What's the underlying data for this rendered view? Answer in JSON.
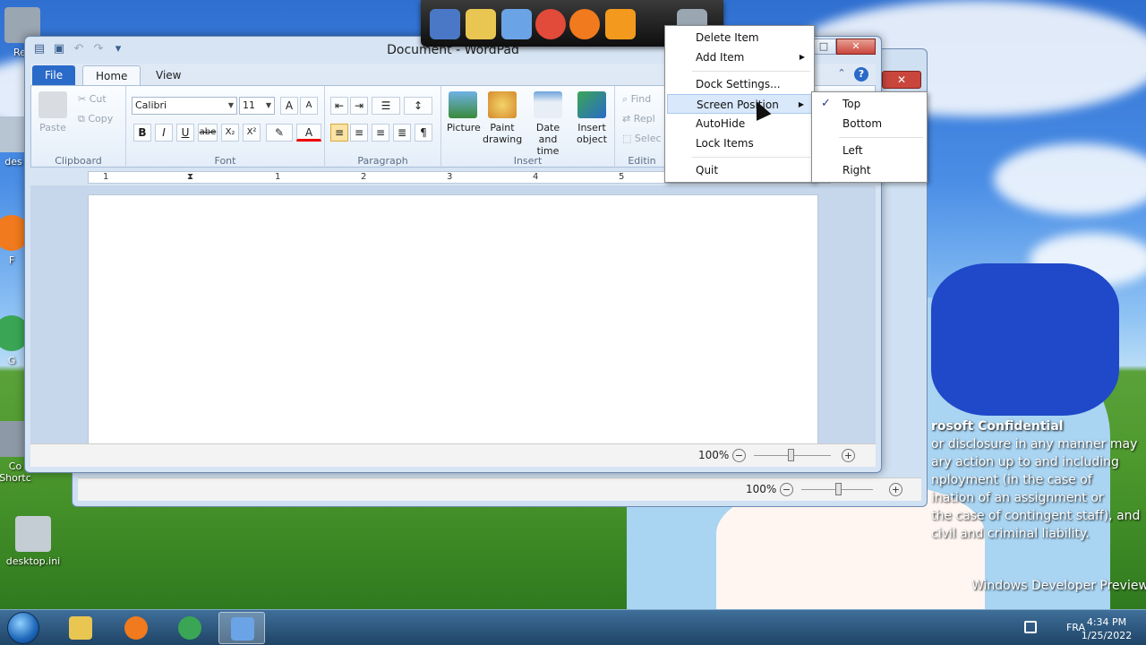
{
  "desktop": {
    "icons": [
      {
        "label": "Rec"
      },
      {
        "label": "des"
      },
      {
        "label": "F"
      },
      {
        "label": "G"
      },
      {
        "label": "Co"
      },
      {
        "label": "Shortc"
      },
      {
        "label": "desktop.ini"
      }
    ],
    "watermark": {
      "title": "rosoft Confidential",
      "lines": [
        "or disclosure in any manner may",
        "ary action up to and including",
        "nployment (in the case of",
        "ination of an assignment or",
        "the case of contingent staff), and",
        "civil and criminal liability."
      ]
    },
    "build_text": "Windows Developer Preview"
  },
  "dock": {
    "items": [
      {
        "icon": "computer-icon",
        "color": "#4a78c6"
      },
      {
        "icon": "folder-icon",
        "color": "#e9c552"
      },
      {
        "icon": "wordpad-icon",
        "color": "#6aa4e6"
      },
      {
        "icon": "chrome-icon",
        "color": "#e24a3a"
      },
      {
        "icon": "firefox-icon",
        "color": "#f07a1d"
      },
      {
        "icon": "media-player-icon",
        "color": "#f39a1e"
      },
      {
        "icon": "recycle-bin-icon",
        "color": "#9aa6b2"
      }
    ]
  },
  "wordpad": {
    "title": "Document - WordPad",
    "tabs": {
      "file": "File",
      "home": "Home",
      "view": "View"
    },
    "clipboard": {
      "paste": "Paste",
      "cut": "Cut",
      "copy": "Copy",
      "label": "Clipboard"
    },
    "font": {
      "family": "Calibri",
      "size": "11",
      "label": "Font",
      "bold": "B",
      "italic": "I",
      "underline": "U",
      "strike": "abe",
      "sub": "X₂",
      "sup": "X²"
    },
    "paragraph": {
      "label": "Paragraph"
    },
    "insert": {
      "picture": "Picture",
      "paint_1": "Paint",
      "paint_2": "drawing",
      "date_1": "Date and",
      "date_2": "time",
      "insert_1": "Insert",
      "insert_2": "object",
      "label": "Insert"
    },
    "editing": {
      "find": "Find",
      "replace": "Repl",
      "select": "Selec",
      "label": "Editin"
    },
    "ruler_numbers": [
      "1",
      "1",
      "2",
      "3",
      "4",
      "5"
    ],
    "zoom": "100%"
  },
  "bg_window": {
    "zoom": "100%",
    "close": "✕"
  },
  "context_menu": {
    "items": [
      {
        "label": "Delete Item"
      },
      {
        "label": "Add Item",
        "submenu": true
      },
      {
        "label": "Dock Settings..."
      },
      {
        "label": "Screen Position",
        "submenu": true,
        "highlighted": true
      },
      {
        "label": "AutoHide"
      },
      {
        "label": "Lock Items"
      },
      {
        "label": "Quit"
      }
    ]
  },
  "submenu": {
    "items": [
      {
        "label": "Top",
        "checked": true
      },
      {
        "label": "Bottom"
      },
      {
        "label": "Left"
      },
      {
        "label": "Right"
      }
    ],
    "check_mark": "✓"
  },
  "taskbar": {
    "language": "FRA",
    "time": "4:34 PM",
    "date": "1/25/2022",
    "buttons": [
      {
        "icon": "explorer-icon",
        "color": "#e9c552"
      },
      {
        "icon": "firefox-icon",
        "color": "#f07a1d"
      },
      {
        "icon": "chrome-icon",
        "color": "#3aa655"
      },
      {
        "icon": "wordpad-icon",
        "color": "#6aa4e6"
      }
    ]
  }
}
